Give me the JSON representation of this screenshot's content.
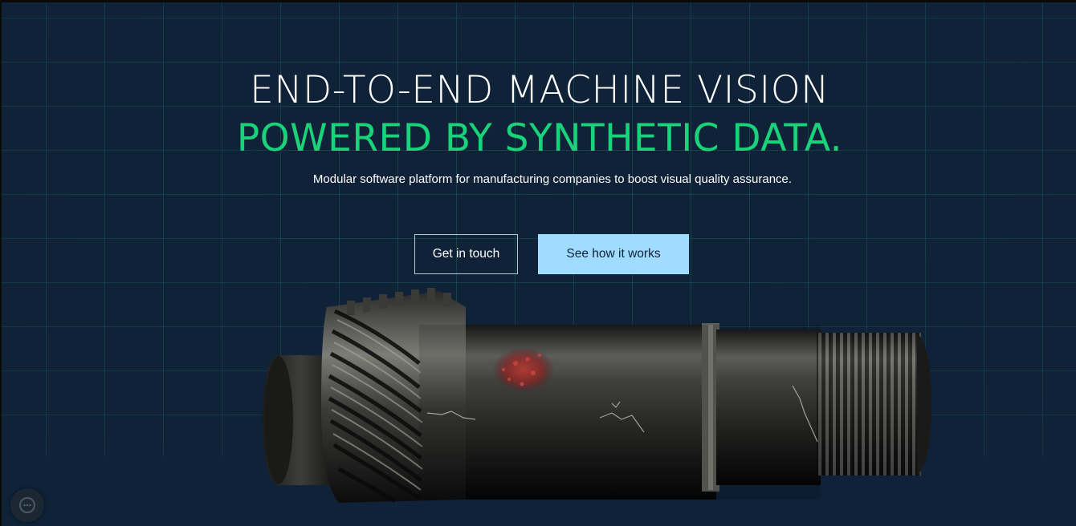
{
  "hero": {
    "headline_line1": "END-TO-END MACHINE VISION",
    "headline_line2": "POWERED BY SYNTHETIC DATA.",
    "subtitle": "Modular software platform for manufacturing companies to boost visual quality assurance."
  },
  "actions": {
    "contact_label": "Get in touch",
    "how_it_works_label": "See how it works"
  },
  "product_image": {
    "subject": "gear shaft with highlighted defect"
  },
  "widget": {
    "icon": "chat-bubble-icon"
  },
  "colors": {
    "background": "#0f2238",
    "accent_green": "#19d37a",
    "button_blue": "#9fdcff",
    "grid_line": "#249678",
    "defect_highlight": "#c23a3a"
  }
}
